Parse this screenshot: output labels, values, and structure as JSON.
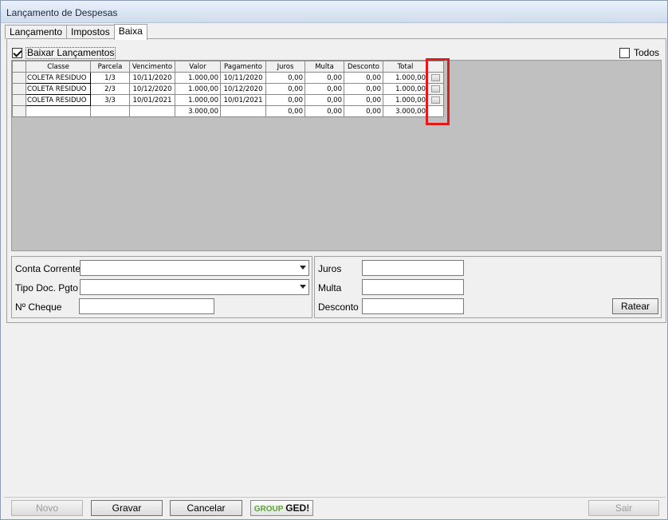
{
  "window": {
    "title": "Lançamento de Despesas"
  },
  "tabs": [
    {
      "label": "Lançamento"
    },
    {
      "label": "Impostos"
    },
    {
      "label": "Baixa"
    }
  ],
  "baixa": {
    "baixar_label": "Baixar Lançamentos",
    "baixar_checked": true,
    "todos_label": "Todos",
    "todos_checked": false
  },
  "grid": {
    "columns": [
      "Classe",
      "Parcela",
      "Vencimento",
      "Valor",
      "Pagamento",
      "Juros",
      "Multa",
      "Desconto",
      "Total"
    ],
    "rows": [
      {
        "classe": "COLETA RESIDUO",
        "parcela": "1/3",
        "vencimento": "10/11/2020",
        "valor": "1.000,00",
        "pagamento": "10/11/2020",
        "juros": "0,00",
        "multa": "0,00",
        "desconto": "0,00",
        "total": "1.000,00"
      },
      {
        "classe": "COLETA RESIDUO",
        "parcela": "2/3",
        "vencimento": "10/12/2020",
        "valor": "1.000,00",
        "pagamento": "10/12/2020",
        "juros": "0,00",
        "multa": "0,00",
        "desconto": "0,00",
        "total": "1.000,00"
      },
      {
        "classe": "COLETA RESIDUO",
        "parcela": "3/3",
        "vencimento": "10/01/2021",
        "valor": "1.000,00",
        "pagamento": "10/01/2021",
        "juros": "0,00",
        "multa": "0,00",
        "desconto": "0,00",
        "total": "1.000,00"
      }
    ],
    "totals": {
      "classe": "",
      "parcela": "",
      "vencimento": "",
      "valor": "3.000,00",
      "pagamento": "",
      "juros": "0,00",
      "multa": "0,00",
      "desconto": "0,00",
      "total": "3.000,00"
    }
  },
  "form": {
    "conta_corrente_label": "Conta Corrente",
    "conta_corrente_value": "",
    "tipo_doc_label": "Tipo Doc. Pgto",
    "tipo_doc_value": "",
    "cheque_label": "Nº Cheque",
    "cheque_value": "",
    "juros_label": "Juros",
    "juros_value": "",
    "multa_label": "Multa",
    "multa_value": "",
    "desconto_label": "Desconto",
    "desconto_value": "",
    "ratear_label": "Ratear"
  },
  "footer": {
    "novo_label": "Novo",
    "gravar_label": "Gravar",
    "cancelar_label": "Cancelar",
    "ged_group": "GROUP",
    "ged_name": "GED!",
    "sair_label": "Sair"
  }
}
